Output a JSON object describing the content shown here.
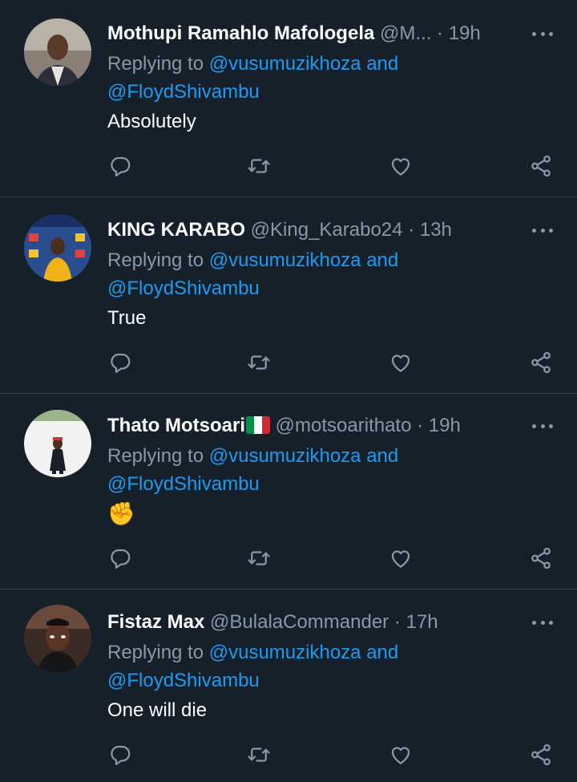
{
  "replying_prefix": "Replying to",
  "mention_1": "@vusumuzikhoza",
  "mention_and": "and",
  "mention_2": "@FloydShivambu",
  "separator": "·",
  "colors": {
    "background": "#15202b",
    "secondary_text": "#8899a6",
    "link": "#1d9bf0",
    "divider": "#38444d"
  },
  "icons": [
    "reply-icon",
    "retweet-icon",
    "like-icon",
    "share-icon",
    "more-icon"
  ],
  "tweets": [
    {
      "name": "Mothupi Ramahlo Mafologela",
      "handle": "@M...",
      "time": "19h",
      "text": "Absolutely"
    },
    {
      "name": "KING KARABO",
      "handle": "@King_Karabo24",
      "time": "13h",
      "text": "True"
    },
    {
      "name": "Thato Motsoari",
      "name_flag": "Italian flag emoji",
      "handle": "@motsoarithato",
      "time": "19h",
      "text": "✊"
    },
    {
      "name": "Fistaz Max",
      "handle": "@BulalaCommander",
      "time": "17h",
      "text": "One will die"
    }
  ]
}
